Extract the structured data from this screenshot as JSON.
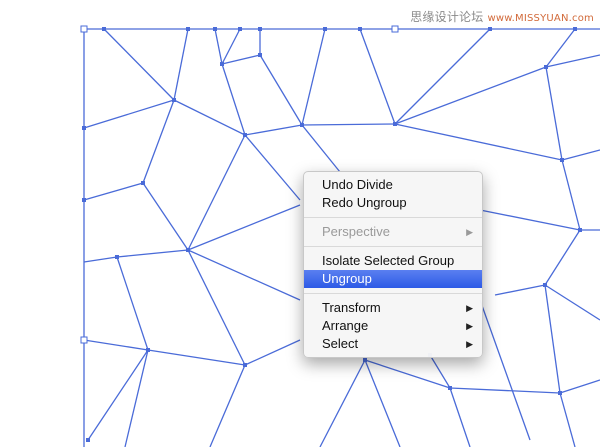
{
  "watermark": {
    "site_name": "思缘设计论坛",
    "url": "www.MISSYUAN.com"
  },
  "canvas": {
    "stroke_color": "#4a6bd8"
  },
  "context_menu": {
    "groups": [
      [
        {
          "label": "Undo Divide",
          "enabled": true,
          "submenu": false
        },
        {
          "label": "Redo Ungroup",
          "enabled": true,
          "submenu": false
        }
      ],
      [
        {
          "label": "Perspective",
          "enabled": false,
          "submenu": true
        }
      ],
      [
        {
          "label": "Isolate Selected Group",
          "enabled": true,
          "submenu": false
        },
        {
          "label": "Ungroup",
          "enabled": true,
          "submenu": false,
          "highlighted": true
        }
      ],
      [
        {
          "label": "Transform",
          "enabled": true,
          "submenu": true
        },
        {
          "label": "Arrange",
          "enabled": true,
          "submenu": true
        },
        {
          "label": "Select",
          "enabled": true,
          "submenu": true
        }
      ]
    ],
    "submenu_arrow_icon": "triangle-right-icon"
  }
}
